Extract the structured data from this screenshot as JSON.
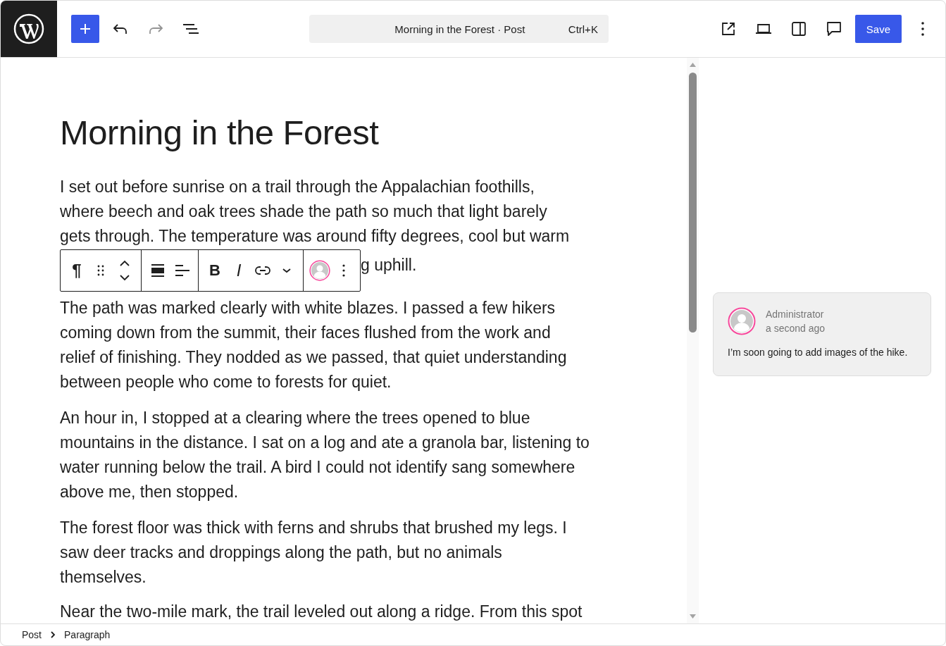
{
  "topbar": {
    "title": "Morning in the Forest · Post",
    "shortcut": "Ctrl+K",
    "save_label": "Save",
    "redo_disabled": true
  },
  "post": {
    "title": "Morning in the Forest",
    "first_paragraph": {
      "lines": [
        "I set out before sunrise on a trail through the Appalachian foothills,",
        "where beech and oak trees shade the path so much that light barely",
        "gets through. The temperature was around fifty degrees, cool but warm"
      ],
      "fragment": "g uphill."
    },
    "paragraphs": [
      {
        "lines": [
          "The path was marked clearly with white blazes. I passed a few hikers",
          "coming down from the summit, their faces flushed from the work and",
          "relief of finishing. They nodded as we passed, that quiet understanding",
          "between people who come to forests for quiet."
        ]
      },
      {
        "lines": [
          "An hour in, I stopped at a clearing where the trees opened to blue",
          "mountains in the distance. I sat on a log and ate a granola bar, listening to",
          "water running below the trail. A bird I could not identify sang somewhere",
          "above me, then stopped."
        ]
      },
      {
        "lines": [
          "The forest floor was thick with ferns and shrubs that brushed my legs. I",
          "saw deer tracks and droppings along the path, but no animals",
          "themselves."
        ]
      },
      {
        "lines": [
          "Near the two-mile mark, the trail leveled out along a ridge. From this spot"
        ]
      }
    ]
  },
  "block_toolbar": {
    "block_icon": "¶",
    "bold": "B",
    "italic": "I"
  },
  "comment": {
    "author": "Administrator",
    "time": "a second ago",
    "text": "I’m soon going to add images of the hike."
  },
  "breadcrumbs": [
    "Post",
    "Paragraph"
  ]
}
